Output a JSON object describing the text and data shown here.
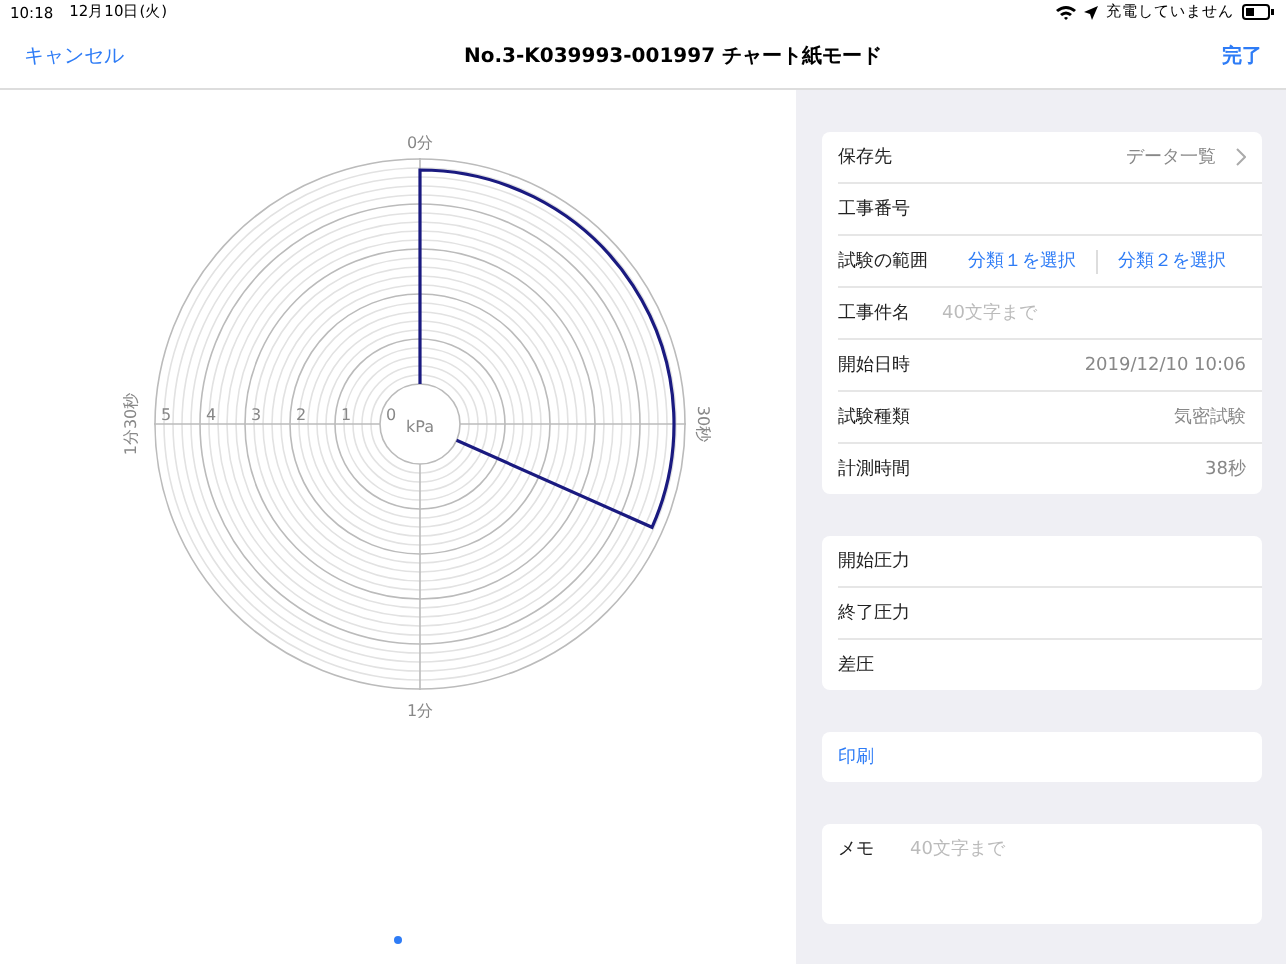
{
  "status_bar": {
    "time": "10:18",
    "date": "12月10日(火)",
    "charging": "充電していません"
  },
  "nav": {
    "cancel": "キャンセル",
    "title": "No.3-K039993-001997 チャート紙モード",
    "done": "完了"
  },
  "chart": {
    "unit": "kPa",
    "ring_labels": [
      "5",
      "4",
      "3",
      "2",
      "1",
      "0"
    ],
    "time_labels": {
      "top": "0分",
      "right": "30秒",
      "bottom": "1分",
      "left": "1分30秒"
    }
  },
  "pager": [
    {
      "selected": true
    }
  ],
  "groups": [
    {
      "rows": [
        {
          "kind": "link",
          "label": "保存先",
          "value": "データ一覧"
        },
        {
          "kind": "plain",
          "label": "工事番号"
        },
        {
          "kind": "segments",
          "label": "試験の範囲",
          "options": [
            "分類１を選択",
            "分類２を選択"
          ]
        },
        {
          "kind": "input",
          "label": "工事件名",
          "placeholder": "40文字まで"
        },
        {
          "kind": "value",
          "label": "開始日時",
          "value": "2019/12/10 10:06"
        },
        {
          "kind": "value",
          "label": "試験種類",
          "value": "気密試験"
        },
        {
          "kind": "value",
          "label": "計測時間",
          "value": "38秒"
        }
      ]
    },
    {
      "rows": [
        {
          "kind": "plain",
          "label": "開始圧力"
        },
        {
          "kind": "plain",
          "label": "終了圧力"
        },
        {
          "kind": "plain",
          "label": "差圧"
        }
      ]
    },
    {
      "rows": [
        {
          "kind": "action",
          "label": "印刷"
        }
      ]
    },
    {
      "rows": [
        {
          "kind": "memo",
          "label": "メモ",
          "placeholder": "40文字まで"
        }
      ]
    }
  ]
}
